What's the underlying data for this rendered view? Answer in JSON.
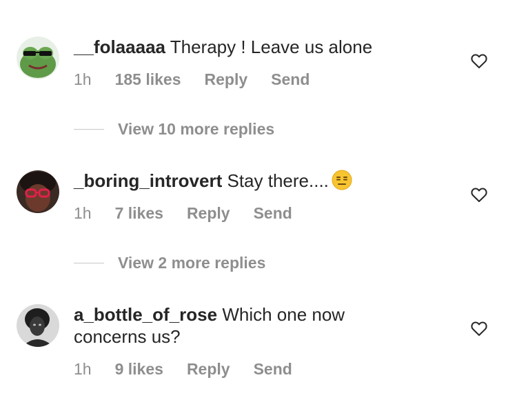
{
  "comments": [
    {
      "username": "__folaaaaa",
      "text": "Therapy ! Leave us alone",
      "time": "1h",
      "likes": "185 likes",
      "reply": "Reply",
      "send": "Send",
      "avatar_icon": "frog-avatar",
      "view_replies": "View 10 more replies"
    },
    {
      "username": "_boring_introvert",
      "text": "Stay there....",
      "emoji": "expressionless-face-emoji",
      "time": "1h",
      "likes": "7 likes",
      "reply": "Reply",
      "send": "Send",
      "avatar_icon": "person-sunglasses-avatar",
      "view_replies": "View 2 more replies"
    },
    {
      "username": "a_bottle_of_rose",
      "text": "Which one now concerns us?",
      "time": "1h",
      "likes": "9 likes",
      "reply": "Reply",
      "send": "Send",
      "avatar_icon": "woman-portrait-avatar"
    }
  ],
  "colors": {
    "text": "#262626",
    "muted": "#8e8e8e",
    "divider": "#c7c7c7"
  }
}
